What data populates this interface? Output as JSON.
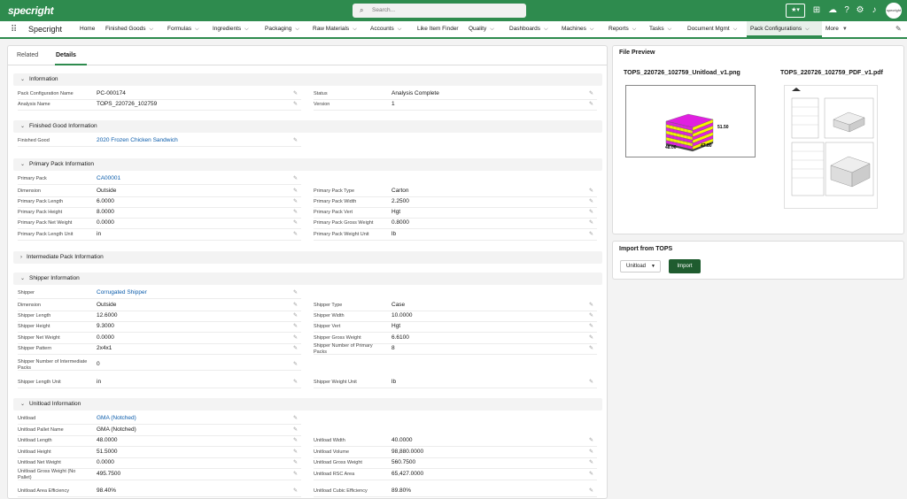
{
  "topbar": {
    "logo": "specright",
    "search_placeholder": "Search...",
    "avatar": "specright",
    "icons": [
      "star-dropdown-icon",
      "plus-icon",
      "cloud-icon",
      "help-icon",
      "gear-icon",
      "bell-icon"
    ]
  },
  "nav": {
    "app_name": "Specright",
    "items": [
      {
        "label": "Home",
        "chevron": false
      },
      {
        "label": "Finished Goods",
        "chevron": true
      },
      {
        "label": "Formulas",
        "chevron": true
      },
      {
        "label": "Ingredients",
        "chevron": true
      },
      {
        "label": "Packaging",
        "chevron": true
      },
      {
        "label": "Raw Materials",
        "chevron": true
      },
      {
        "label": "Accounts",
        "chevron": true
      },
      {
        "label": "Like Item Finder",
        "chevron": false
      },
      {
        "label": "Quality",
        "chevron": true
      },
      {
        "label": "Dashboards",
        "chevron": true
      },
      {
        "label": "Machines",
        "chevron": true
      },
      {
        "label": "Reports",
        "chevron": true
      },
      {
        "label": "Tasks",
        "chevron": true
      },
      {
        "label": "Document Mgmt",
        "chevron": true
      },
      {
        "label": "Pack Configurations",
        "chevron": true,
        "active": true
      },
      {
        "label": "More",
        "chevron": true
      }
    ]
  },
  "tabs": [
    "Related",
    "Details"
  ],
  "sections": [
    {
      "title": "Information",
      "expanded": true,
      "rows": [
        {
          "l": {
            "label": "Pack Configuration Name",
            "value": "PC-000174"
          },
          "r": {
            "label": "Status",
            "value": "Analysis Complete"
          }
        },
        {
          "l": {
            "label": "Analysis Name",
            "value": "TOPS_220726_102759"
          },
          "r": {
            "label": "Version",
            "value": "1"
          }
        }
      ]
    },
    {
      "title": "Finished Good Information",
      "expanded": true,
      "rows": [
        {
          "l": {
            "label": "Finished Good",
            "value": "2020 Frozen Chicken Sandwich",
            "link": true
          }
        }
      ]
    },
    {
      "title": "Primary Pack Information",
      "expanded": true,
      "rows": [
        {
          "l": {
            "label": "Primary Pack",
            "value": "CA00001",
            "link": true
          }
        },
        {
          "l": {
            "label": "Dimension",
            "value": "Outside"
          },
          "r": {
            "label": "Primary Pack Type",
            "value": "Carton"
          }
        },
        {
          "l": {
            "label": "Primary Pack Length",
            "value": "6.0000"
          },
          "r": {
            "label": "Primary Pack Width",
            "value": "2.2500"
          }
        },
        {
          "l": {
            "label": "Primary Pack Height",
            "value": "8.0000"
          },
          "r": {
            "label": "Primary Pack Vert",
            "value": "Hgt"
          }
        },
        {
          "l": {
            "label": "Primary Pack Net Weight",
            "value": "0.0000"
          },
          "r": {
            "label": "Primary Pack Gross Weight",
            "value": "0.8000"
          }
        },
        {
          "l": {
            "label": "Primary Pack Length Unit",
            "value": "in"
          },
          "r": {
            "label": "Primary Pack Weight Unit",
            "value": "lb"
          }
        }
      ]
    },
    {
      "title": "Intermediate Pack Information",
      "expanded": false,
      "rows": []
    },
    {
      "title": "Shipper Information",
      "expanded": true,
      "rows": [
        {
          "l": {
            "label": "Shipper",
            "value": "Corrugated Shipper",
            "link": true
          }
        },
        {
          "l": {
            "label": "Dimension",
            "value": "Outside"
          },
          "r": {
            "label": "Shipper Type",
            "value": "Case"
          }
        },
        {
          "l": {
            "label": "Shipper Length",
            "value": "12.6000"
          },
          "r": {
            "label": "Shipper Width",
            "value": "10.0000"
          }
        },
        {
          "l": {
            "label": "Shipper Height",
            "value": "9.3000"
          },
          "r": {
            "label": "Shipper Vert",
            "value": "Hgt"
          }
        },
        {
          "l": {
            "label": "Shipper Net Weight",
            "value": "0.0000"
          },
          "r": {
            "label": "Shipper Gross Weight",
            "value": "6.6100"
          }
        },
        {
          "l": {
            "label": "Shipper Pattern",
            "value": "2x4x1"
          },
          "r": {
            "label": "Shipper Number of Primary Packs",
            "value": "8"
          }
        },
        {
          "l": {
            "label": "Shipper Number of Intermediate Packs",
            "value": "0"
          }
        },
        {
          "l": {
            "label": "Shipper Length Unit",
            "value": "in"
          },
          "r": {
            "label": "Shipper Weight Unit",
            "value": "lb"
          }
        }
      ]
    },
    {
      "title": "Unitload Information",
      "expanded": true,
      "rows": [
        {
          "l": {
            "label": "Unitload",
            "value": "GMA (Notched)",
            "link": true
          }
        },
        {
          "l": {
            "label": "Unitload Pallet Name",
            "value": "GMA (Notched)"
          }
        },
        {
          "l": {
            "label": "Unitload Length",
            "value": "48.0000"
          },
          "r": {
            "label": "Unitload Width",
            "value": "40.0000"
          }
        },
        {
          "l": {
            "label": "Unitload Height",
            "value": "51.5000"
          },
          "r": {
            "label": "Unitload Volume",
            "value": "98,880.0000"
          }
        },
        {
          "l": {
            "label": "Unitload Net Weight",
            "value": "0.0000"
          },
          "r": {
            "label": "Unitload Gross Weight",
            "value": "560.7500"
          }
        },
        {
          "l": {
            "label": "Unitload Gross Weight (No Pallet)",
            "value": "495.7500"
          },
          "r": {
            "label": "Unitload RSC Area",
            "value": "65,427.0000"
          }
        },
        {
          "l": {
            "label": "Unitload Area Efficiency",
            "value": "98.40%"
          },
          "r": {
            "label": "Unitload Cubic Efficiency",
            "value": "89.80%"
          }
        }
      ]
    }
  ],
  "file_preview": {
    "title": "File Preview",
    "files": [
      "TOPS_220726_102759_Unitload_v1.png",
      "TOPS_220726_102759_PDF_v1.pdf"
    ],
    "dims": {
      "height": "51.50",
      "length": "48.00",
      "width": "47.80"
    }
  },
  "import": {
    "title": "Import from TOPS",
    "select_value": "Unitload",
    "button": "Import"
  },
  "colors": {
    "brand": "#2e8b4e",
    "link": "#0b5cab",
    "import_button": "#1f5c2f",
    "pallet_magenta": "#e020e0",
    "pallet_yellow": "#f4f400"
  }
}
